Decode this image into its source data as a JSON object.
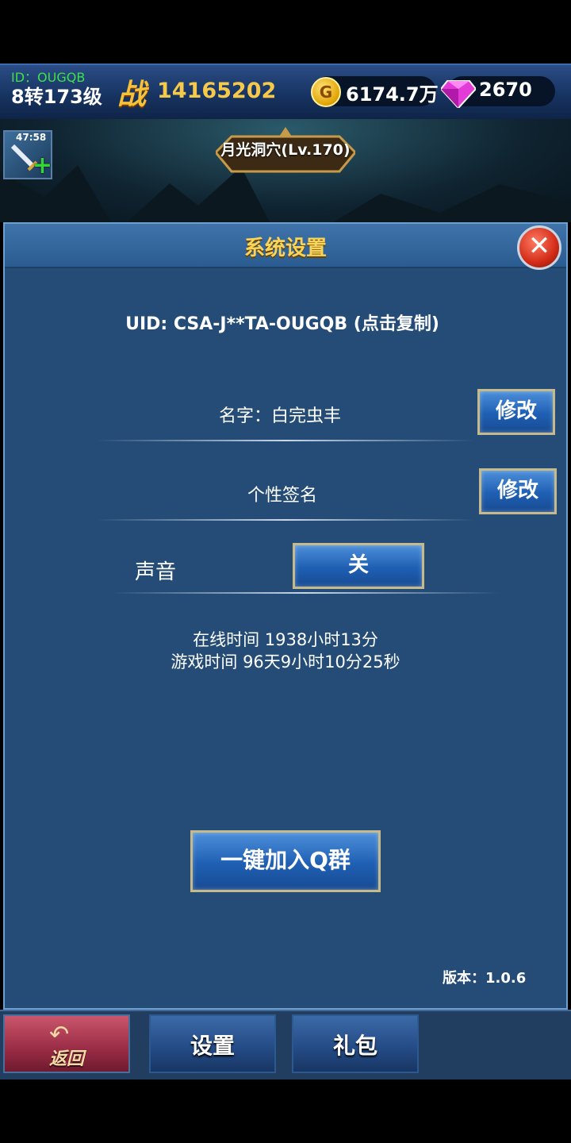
{
  "hud": {
    "player_id": "ID：OUGQB",
    "level": "8转173级",
    "power_glyph": "战",
    "power": "14165202",
    "gold_glyph": "G",
    "gold": "6174.7万",
    "gems": "2670"
  },
  "scene": {
    "buff_timer": "47:58",
    "map_name": "月光洞穴(Lv.170)"
  },
  "panel": {
    "title": "系统设置",
    "close_glyph": "✕",
    "uid_text": "UID: CSA-J**TA-OUGQB (点击复制)",
    "name_label": "名字：白完虫丰",
    "name_button": "修改",
    "signature_label": "个性签名",
    "signature_button": "修改",
    "sound_label": "声音",
    "sound_button": "关",
    "online_time": "在线时间 1938小时13分",
    "game_time": "游戏时间 96天9小时10分25秒",
    "qq_group_button": "一键加入Q群",
    "version": "版本：1.0.6"
  },
  "bottom_bar": {
    "back_label": "返回",
    "settings_label": "设置",
    "gift_label": "礼包"
  },
  "colors": {
    "panel_bg": "#244c76",
    "title_gold": "#f7d55c",
    "button_blue": "#1f5fb3",
    "uid_green": "#3ee04a"
  }
}
